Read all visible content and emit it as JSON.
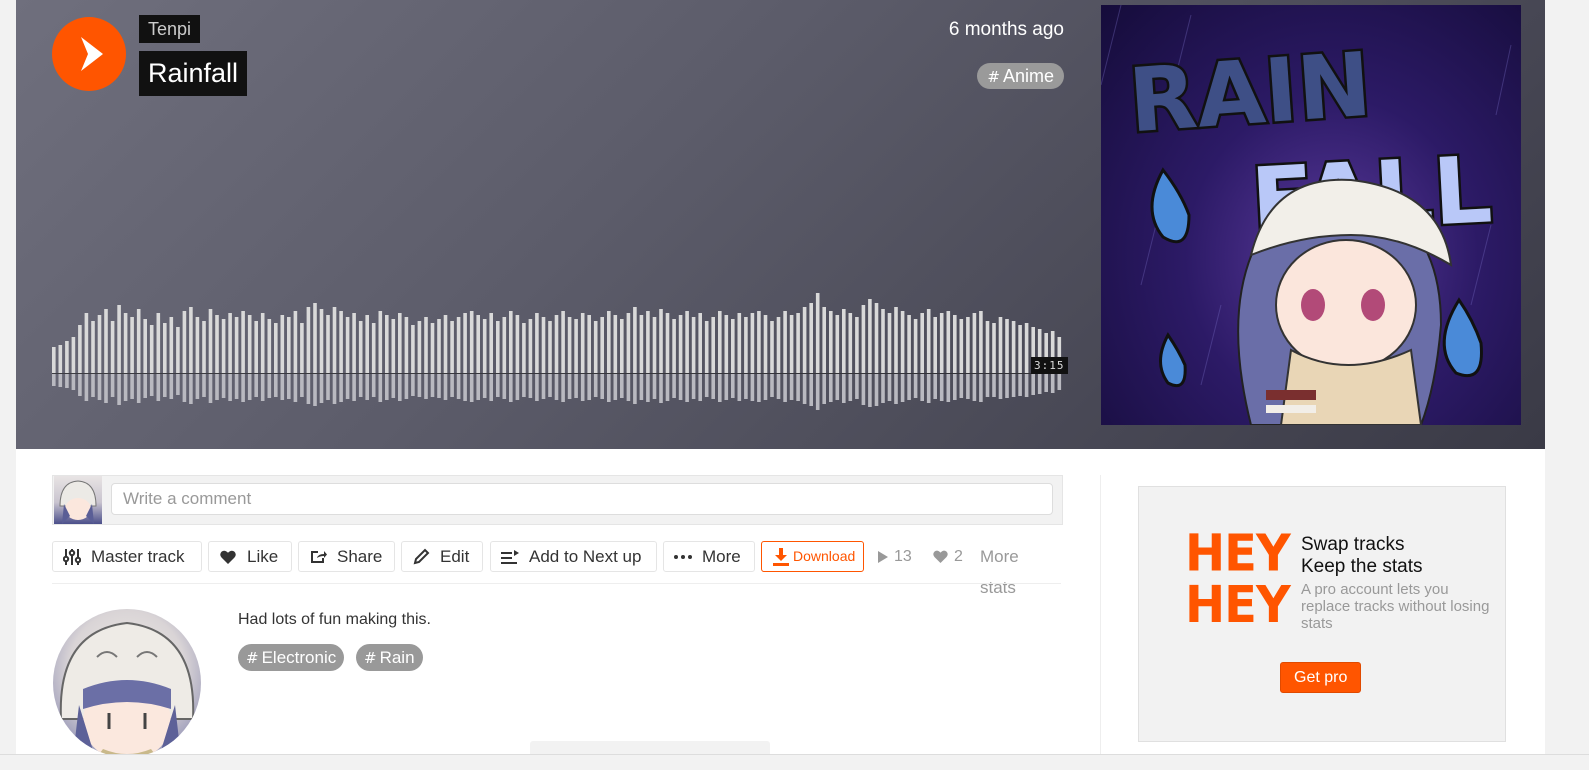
{
  "track": {
    "artist": "Tenpi",
    "title": "Rainfall",
    "posted": "6 months ago",
    "genre_tag": "Anime",
    "duration": "3:15",
    "artwork_text_line1": "RAIN",
    "artwork_text_line2": "FALL"
  },
  "waveform": {
    "color": "#d9d9d9",
    "heights": [
      26,
      28,
      32,
      36,
      48,
      60,
      52,
      58,
      64,
      52,
      68,
      60,
      56,
      64,
      54,
      48,
      60,
      50,
      56,
      46,
      62,
      66,
      56,
      52,
      64,
      58,
      54,
      60,
      56,
      62,
      58,
      52,
      60,
      54,
      50,
      58,
      56,
      62,
      50,
      66,
      70,
      64,
      58,
      66,
      62,
      56,
      60,
      52,
      58,
      50,
      62,
      58,
      54,
      60,
      56,
      48,
      52,
      56,
      50,
      54,
      58,
      52,
      56,
      60,
      62,
      58,
      54,
      60,
      52,
      56,
      62,
      58,
      50,
      54,
      60,
      56,
      52,
      58,
      62,
      56,
      54,
      60,
      58,
      52,
      56,
      62,
      58,
      54,
      60,
      66,
      58,
      62,
      56,
      64,
      60,
      54,
      58,
      62,
      56,
      60,
      52,
      56,
      62,
      58,
      54,
      60,
      56,
      60,
      62,
      58,
      52,
      56,
      62,
      58,
      60,
      66,
      70,
      80,
      66,
      62,
      58,
      64,
      60,
      56,
      68,
      74,
      70,
      64,
      60,
      66,
      62,
      58,
      54,
      60,
      64,
      56,
      60,
      62,
      58,
      54,
      56,
      60,
      62,
      52,
      50,
      56,
      54,
      52,
      48,
      50,
      46,
      44,
      40,
      42,
      36
    ]
  },
  "comment": {
    "placeholder": "Write a comment"
  },
  "actions": {
    "master_track": "Master track",
    "like": "Like",
    "share": "Share",
    "edit": "Edit",
    "add_next": "Add to Next up",
    "more": "More",
    "download": "Download",
    "plays": "13",
    "likes": "2",
    "more_stats": "More stats"
  },
  "description": {
    "text": "Had lots of fun making this.",
    "tags": [
      "Electronic",
      "Rain"
    ]
  },
  "ad": {
    "hey1": "HEY",
    "hey2": "HEY",
    "head1": "Swap tracks",
    "head2": "Keep the stats",
    "body": "A pro account lets you replace tracks without losing stats",
    "cta": "Get pro"
  },
  "colors": {
    "accent": "#ff5500",
    "hero_bg": "#5c5c6a",
    "tag_bg": "#999999"
  }
}
